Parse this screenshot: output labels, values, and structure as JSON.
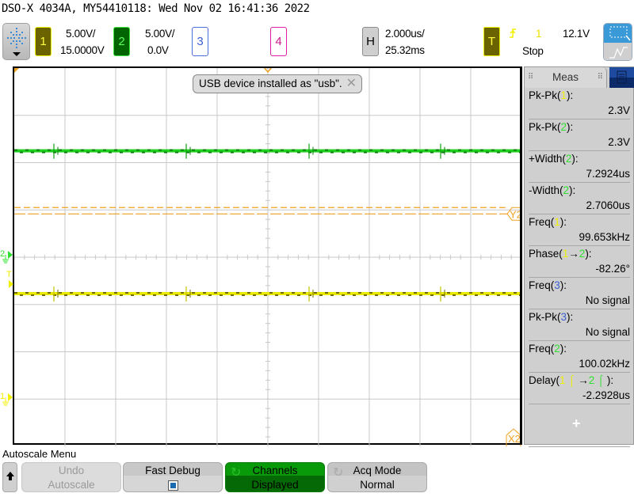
{
  "window": {
    "title": "DSO-X 4034A, MY54410118: Wed Nov 02 16:41:36 2022"
  },
  "header": {
    "channels": [
      {
        "id": "1",
        "scale": "5.00V/",
        "offset": "15.0000V",
        "color": "#f0f000",
        "active": true
      },
      {
        "id": "2",
        "scale": "5.00V/",
        "offset": "0.0V",
        "color": "#30e030",
        "active": true
      },
      {
        "id": "3",
        "scale": "",
        "offset": "",
        "color": "#3a60d0",
        "active": false
      },
      {
        "id": "4",
        "scale": "",
        "offset": "",
        "color": "#d01890",
        "active": false
      }
    ],
    "horizontal": {
      "label": "H",
      "timebase": "2.000us/",
      "delay": "25.32ms"
    },
    "trigger": {
      "label": "T",
      "slope_icon": "rising-edge-icon",
      "source": "1",
      "level": "12.1V",
      "run_state": "Stop"
    },
    "logo_icon": "keysight-spark-icon",
    "zoom_icon": "select-zoom-icon",
    "wave_icon": "waveform-icon"
  },
  "display": {
    "notification": "USB device installed as \"usb\".",
    "cursor_labels": {
      "y2": "Y2",
      "x2": "X2"
    },
    "markers": {
      "ch1": "1",
      "ch2": "2",
      "trigger": "T"
    },
    "traces": [
      {
        "channel": "1",
        "color": "#e8e800",
        "level_div": -0.77
      },
      {
        "channel": "2",
        "color": "#20d020",
        "level_div": 2.25
      }
    ],
    "cursor_y2_div": 1.05,
    "cursor_y1_div": 1.15,
    "grid": {
      "h_divs": 10,
      "v_divs": 8
    }
  },
  "measurements": {
    "tab_label": "Meas",
    "items": [
      {
        "label": "Pk-Pk(",
        "src": "1",
        "src_class": "c1",
        "suffix": "):",
        "value": "2.3V"
      },
      {
        "label": "Pk-Pk(",
        "src": "2",
        "src_class": "c2",
        "suffix": "):",
        "value": "2.3V"
      },
      {
        "label": "+Width(",
        "src": "2",
        "src_class": "c2",
        "suffix": "):",
        "value": "7.2924us"
      },
      {
        "label": "-Width(",
        "src": "2",
        "src_class": "c2",
        "suffix": "):",
        "value": "2.7060us"
      },
      {
        "label": "Freq(",
        "src": "1",
        "src_class": "c1",
        "suffix": "):",
        "value": "99.653kHz"
      },
      {
        "label": "Phase(",
        "src": "1→2",
        "src_class": "phase",
        "suffix": "):",
        "value": "-82.26°"
      },
      {
        "label": "Freq(",
        "src": "3",
        "src_class": "c3",
        "suffix": "):",
        "value": "No signal"
      },
      {
        "label": "Pk-Pk(",
        "src": "3",
        "src_class": "c3",
        "suffix": "):",
        "value": "No signal"
      },
      {
        "label": "Freq(",
        "src": "2",
        "src_class": "c2",
        "suffix": "):",
        "value": "100.02kHz"
      },
      {
        "label": "Delay(",
        "src": "1↑→2↑",
        "src_class": "delay",
        "suffix": "):",
        "value": "-2.2928us"
      }
    ],
    "add_label": "+"
  },
  "softkeys": {
    "menu_title": "Autoscale Menu",
    "up_icon": "up-arrow-icon",
    "keys": [
      {
        "line1": "Undo",
        "line2": "Autoscale",
        "enabled": false
      },
      {
        "line1": "Fast Debug",
        "line2": "",
        "checked": true
      },
      {
        "line1": "Channels",
        "line2": "Displayed"
      },
      {
        "line1": "Acq Mode",
        "line2": "Normal"
      }
    ]
  }
}
